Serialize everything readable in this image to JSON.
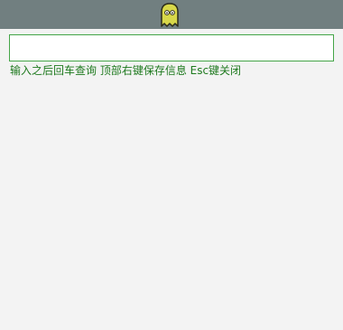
{
  "header": {
    "icon": "ghost-icon",
    "background": "#717f80",
    "icon_color": "#d8d84a"
  },
  "query": {
    "value": "",
    "placeholder": "",
    "border_color": "#44a548"
  },
  "hint": {
    "text": "输入之后回车查询 顶部右键保存信息 Esc键关闭",
    "color": "#1f7a1f"
  }
}
